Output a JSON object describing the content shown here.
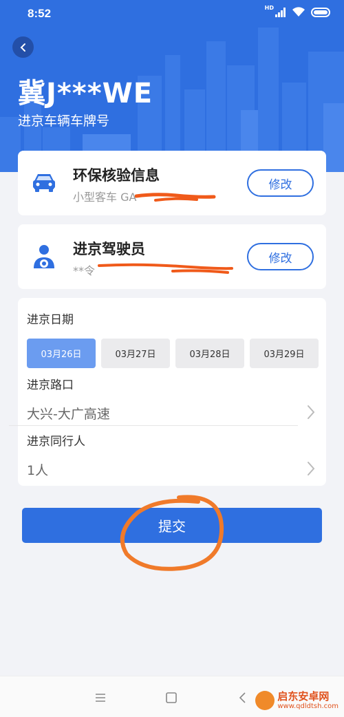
{
  "status_bar": {
    "time": "8:52",
    "hd_label": "HD",
    "icons": [
      "signal-icon",
      "wifi-icon",
      "battery-icon"
    ]
  },
  "header": {
    "plate_number": "冀J***WE",
    "plate_label": "进京车辆车牌号",
    "back_icon": "chevron-left-icon"
  },
  "vehicle_card": {
    "title": "环保核验信息",
    "subtitle": "小型客车  GA",
    "edit_label": "修改",
    "icon": "car-icon"
  },
  "driver_card": {
    "title": "进京驾驶员",
    "subtitle": "**令 ",
    "edit_label": "修改",
    "icon": "driver-icon"
  },
  "form": {
    "date_label": "进京日期",
    "dates": [
      {
        "label": "03月26日",
        "selected": true
      },
      {
        "label": "03月27日",
        "selected": false
      },
      {
        "label": "03月28日",
        "selected": false
      },
      {
        "label": "03月29日",
        "selected": false
      }
    ],
    "entry_label": "进京路口",
    "entry_value": "大兴-大广高速",
    "companion_label": "进京同行人",
    "companion_value": "1人"
  },
  "submit_label": "提交",
  "nav": {
    "icons": [
      "menu-icon",
      "home-square-icon",
      "back-triangle-icon"
    ]
  },
  "watermark": {
    "name": "启东安卓网",
    "url": "www.qdldtsh.com"
  },
  "colors": {
    "primary": "#2f6fe0",
    "selected_chip": "#6b9cf0",
    "annotation": "#f07a2a"
  }
}
